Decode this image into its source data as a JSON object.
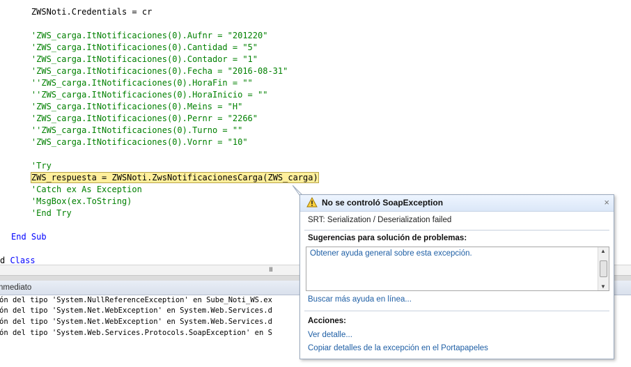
{
  "editor": {
    "lines": [
      {
        "text": "    ZWSNoti.Credentials = cr",
        "kind": "plain",
        "highlight": false
      },
      {
        "text": "",
        "kind": "plain",
        "highlight": false
      },
      {
        "text": "    'ZWS_carga.ItNotificaciones(0).Aufnr = \"201220\"",
        "kind": "comment",
        "highlight": false
      },
      {
        "text": "    'ZWS_carga.ItNotificaciones(0).Cantidad = \"5\"",
        "kind": "comment",
        "highlight": false
      },
      {
        "text": "    'ZWS_carga.ItNotificaciones(0).Contador = \"1\"",
        "kind": "comment",
        "highlight": false
      },
      {
        "text": "    'ZWS_carga.ItNotificaciones(0).Fecha = \"2016-08-31\"",
        "kind": "comment",
        "highlight": false
      },
      {
        "text": "    ''ZWS_carga.ItNotificaciones(0).HoraFin = \"\"",
        "kind": "comment",
        "highlight": false
      },
      {
        "text": "    ''ZWS_carga.ItNotificaciones(0).HoraInicio = \"\"",
        "kind": "comment",
        "highlight": false
      },
      {
        "text": "    'ZWS_carga.ItNotificaciones(0).Meins = \"H\"",
        "kind": "comment",
        "highlight": false
      },
      {
        "text": "    'ZWS_carga.ItNotificaciones(0).Pernr = \"2266\"",
        "kind": "comment",
        "highlight": false
      },
      {
        "text": "    ''ZWS_carga.ItNotificaciones(0).Turno = \"\"",
        "kind": "comment",
        "highlight": false
      },
      {
        "text": "    'ZWS_carga.ItNotificaciones(0).Vornr = \"10\"",
        "kind": "comment",
        "highlight": false
      },
      {
        "text": "",
        "kind": "plain",
        "highlight": false
      },
      {
        "text": "    'Try",
        "kind": "comment",
        "highlight": false
      },
      {
        "text": "    ZWS_respuesta = ZWSNoti.ZwsNotificacionesCarga(ZWS_carga)",
        "kind": "plain",
        "highlight": true
      },
      {
        "text": "    'Catch ex As Exception",
        "kind": "comment",
        "highlight": false
      },
      {
        "text": "    'MsgBox(ex.ToString)",
        "kind": "comment",
        "highlight": false
      },
      {
        "text": "    'End Try",
        "kind": "comment",
        "highlight": false
      },
      {
        "text": "",
        "kind": "plain",
        "highlight": false
      },
      {
        "text": "End Sub",
        "kind": "keyword",
        "highlight": false
      },
      {
        "text": "",
        "kind": "plain",
        "highlight": false
      },
      {
        "text": "d Class",
        "kind": "keyword",
        "highlight": false
      }
    ]
  },
  "hscroll": {
    "grip": "III"
  },
  "immediate": {
    "title": "nmediato",
    "lines": [
      "ón del tipo 'System.NullReferenceException' en Sube_Noti_WS.ex",
      "ón del tipo 'System.Net.WebException' en System.Web.Services.d",
      "ón del tipo 'System.Net.WebException' en System.Web.Services.d",
      "ón del tipo 'System.Web.Services.Protocols.SoapException' en S"
    ]
  },
  "exception": {
    "title": "No se controló SoapException",
    "close": "×",
    "message": "SRT: Serialization / Deserialization failed",
    "tips_heading": "Sugerencias para solución de problemas:",
    "tip": "Obtener ayuda general sobre esta excepción.",
    "more_help": "Buscar más ayuda en línea...",
    "actions_heading": "Acciones:",
    "actions": [
      "Ver detalle...",
      "Copiar detalles de la excepción en el Portapapeles"
    ],
    "scroll_up": "▲",
    "scroll_down": "▼"
  },
  "colors": {
    "keyword": "#0000ff",
    "comment": "#008000",
    "highlight": "#ffef9c",
    "link": "#1f5fa5"
  }
}
